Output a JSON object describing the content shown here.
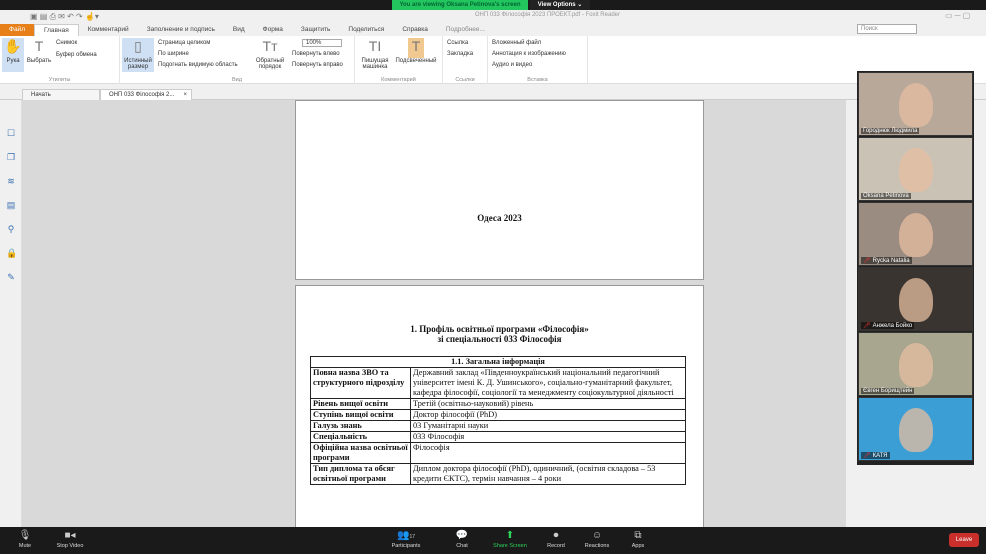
{
  "zoom_banner": {
    "viewing": "You are viewing Oksana Petinova's screen",
    "view_options": "View Options ⌄"
  },
  "app": {
    "title": "ОНП 033 Філософія 2023 ПРОЕКТ.pdf - Foxit Reader",
    "menu": [
      "Файл",
      "Главная",
      "Комментарий",
      "Заполнение и подпись",
      "Вид",
      "Форма",
      "Защитить",
      "Поделиться",
      "Справка",
      "Подробнее..."
    ],
    "search_placeholder": "Поиск",
    "ribbon": {
      "utilities": {
        "hand": "Рука",
        "select": "Выбрать",
        "snapshot": "Снимок",
        "clipboard": "Буфер обмена",
        "label": "Утилиты"
      },
      "view": {
        "actual": "Истинный размер",
        "fit_page": "Страница целиком",
        "fit_width": "По ширине",
        "fit_visible": "Подогнать видимую область",
        "reverse": "Обратный порядок",
        "zoom": "100%",
        "rotate_left": "Повернуть влево",
        "rotate_right": "Повернуть вправо",
        "label": "Вид"
      },
      "comment": {
        "typewriter": "Пишущая машинка",
        "highlight": "Подсвеченный",
        "label": "Комментарий"
      },
      "links": {
        "link": "Ссылка",
        "bookmark": "Закладка",
        "label": "Ссылки"
      },
      "insert": {
        "file": "Вложенный файл",
        "image": "Аннотация к изображению",
        "av": "Аудио и видео",
        "label": "Вставка"
      }
    },
    "tabs": [
      "Начать",
      "ОНП 033 Філософія 2..."
    ]
  },
  "document": {
    "page1_text": "Одеса  2023",
    "heading1": "1.  Профіль освітньої програми «Філософія»",
    "heading2": "зі спеціальності 033 Філософія",
    "table_title": "1.1. Загальна інформація",
    "rows": [
      [
        "Повна назва ЗВО та структурного підрозділу",
        "Державний заклад «Південноукраїнський національний педагогічний університет імені К. Д. Ушинського», соціально-гуманітарний факультет, кафедра філософії, соціології та менеджменту соціокультурної діяльності"
      ],
      [
        "Рівень вищої освіти",
        "Третій (освітньо-науковий) рівень"
      ],
      [
        "Ступінь вищої освіти",
        "Доктор філософії (PhD)"
      ],
      [
        "Галузь знань",
        "03 Гуманітарні науки"
      ],
      [
        "Спеціальність",
        "033 Філософія"
      ],
      [
        "Офіційна назва освітньої програми",
        "Філософія"
      ],
      [
        "Тип диплома та обсяг освітньої програми",
        "Диплом доктора філософії (PhD), одиничний, (освітня складова – 53 кредити ЄКТС), термін навчання – 4 роки"
      ]
    ]
  },
  "participants": [
    {
      "name": "Городнюк Людмила",
      "bg": "#b8a89a",
      "muted": false
    },
    {
      "name": "Oksana Petinova",
      "bg": "#c9c2b5",
      "muted": false
    },
    {
      "name": "Rycka Natalia",
      "bg": "#9a8c80",
      "muted": true
    },
    {
      "name": "Анжела Бойко",
      "bg": "#3a3430",
      "muted": true
    },
    {
      "name": "Євген Борищтейн",
      "bg": "#a9a690",
      "muted": false
    },
    {
      "name": "КАТЯ",
      "bg": "#3b9fd6",
      "muted": true
    }
  ],
  "zoom_bar": {
    "mute": "Mute",
    "video": "Stop Video",
    "participants": "Participants",
    "participant_count": "17",
    "chat": "Chat",
    "share": "Share Screen",
    "record": "Record",
    "reactions": "Reactions",
    "apps": "Apps",
    "leave": "Leave"
  }
}
